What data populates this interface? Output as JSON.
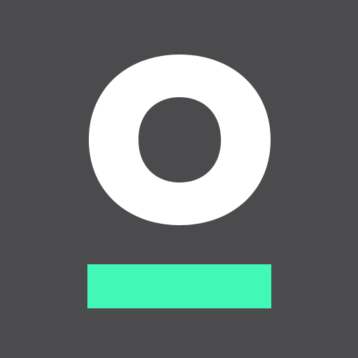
{
  "icon": {
    "name": "app-logo-icon",
    "colors": {
      "background": "#4b4b4d",
      "ring": "#ffffff",
      "bar": "#42f8b8"
    }
  }
}
